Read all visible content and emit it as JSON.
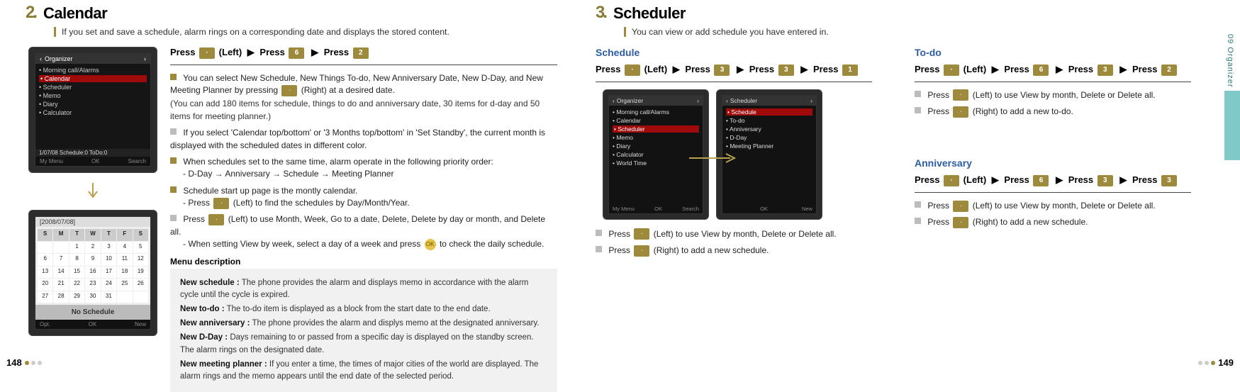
{
  "side_label": "09  Organizer",
  "page_left": "148",
  "page_right": "149",
  "calendar": {
    "num": "2",
    "dot": ".",
    "title": "Calendar",
    "sub": "If you set and save a schedule, alarm rings on a corresponding date and displays the stored content.",
    "press": {
      "p1": "Press",
      "left": "(Left)",
      "arrow": "▶",
      "p2": "Press",
      "p3": "Press",
      "k1": "·",
      "k2": "6",
      "k3": "2"
    },
    "phone1": {
      "title": "Organizer",
      "rows": [
        "Morning call/Alarms",
        "Calendar",
        "Scheduler",
        "Memo",
        "Diary",
        "Calculator"
      ],
      "sel_idx": 1,
      "date": "1/07/08   Schedule:0   ToDo:0",
      "foot": [
        "My Menu",
        "OK",
        "Search"
      ]
    },
    "phone2": {
      "title": "[2008/07/08]",
      "dow": [
        "S",
        "M",
        "T",
        "W",
        "T",
        "F",
        "S"
      ],
      "days": [
        "",
        "",
        "1",
        "2",
        "3",
        "4",
        "5",
        "6",
        "7",
        "8",
        "9",
        "10",
        "11",
        "12",
        "13",
        "14",
        "15",
        "16",
        "17",
        "18",
        "19",
        "20",
        "21",
        "22",
        "23",
        "24",
        "25",
        "26",
        "27",
        "28",
        "29",
        "30",
        "31",
        "",
        ""
      ],
      "nosched": "No Schedule",
      "foot": [
        "Opt.",
        "OK",
        "New"
      ]
    },
    "bullets": [
      {
        "html": [
          "You can select New Schedule, New Things To-do, New Anniversary Date, New D-Day, and New Meeting Planner by pressing ",
          " (Right) at a desired date."
        ],
        "note": "(You can add 180 items for schedule, things to do and anniversary date, 30 items for d-day and 50 items for meeting planner.)"
      },
      {
        "text": "If you select 'Calendar top/bottom' or '3 Months top/bottom' in 'Set Standby', the current month is displayed with the scheduled dates in different color."
      },
      {
        "text": "When schedules set to the same time, alarm operate in the following priority order:",
        "sub": "D-Day → Anniversary → Schedule → Meeting Planner"
      },
      {
        "text": "Schedule start up page is the montly calendar.",
        "sub2": [
          "Press ",
          " (Left) to find the schedules by Day/Month/Year."
        ]
      },
      {
        "html": [
          "Press ",
          " (Left) to use Month, Week, Go to a date, Delete, Delete by day or month, and Delete all."
        ],
        "sub2b": [
          "When setting View by week, select a day of a week and press ",
          "  to check the daily schedule."
        ]
      }
    ],
    "menu_title": "Menu description",
    "menu": [
      {
        "lbl": "New schedule :",
        "txt": "The phone provides the alarm and displays memo in accordance with the alarm cycle until the cycle is expired."
      },
      {
        "lbl": "New to-do :",
        "txt": "The to-do item is displayed as a block from the start date to the end date."
      },
      {
        "lbl": "New anniversary :",
        "txt": "The phone provides the alarm and displys memo at the designated anniversary."
      },
      {
        "lbl": "New D-Day :",
        "txt": "Days remaining to or passed from a specific day is displayed on the standby screen. The alarm rings on the designated date."
      },
      {
        "lbl": "New meeting planner :",
        "txt": "If you enter a time, the times of major cities of the world are displayed. The alarm rings and the memo appears until the end date of the selected period."
      }
    ]
  },
  "scheduler": {
    "num": "3",
    "dot": ".",
    "title": "Scheduler",
    "sub": "You can view or add schedule you have entered in.",
    "schedule": {
      "title": "Schedule",
      "press": {
        "p": "Press",
        "left": "(Left)",
        "arrow": "▶",
        "k1": "·",
        "k2": "3",
        "k3": "3",
        "k4": "1"
      },
      "phoneL": {
        "title": "Organizer",
        "rows": [
          "Morning call/Alarms",
          "Calendar",
          "Scheduler",
          "Memo",
          "Diary",
          "Calculator",
          "World Time"
        ],
        "sel_idx": 2,
        "foot": [
          "My Menu",
          "OK",
          "Search"
        ]
      },
      "phoneR": {
        "title": "Scheduler",
        "rows": [
          "Schedule",
          "To-do",
          "Anniversary",
          "D-Day",
          "Meeting Planner"
        ],
        "sel_idx": 0,
        "foot": [
          "",
          "OK",
          "New"
        ]
      },
      "b1": [
        "Press ",
        " (Left) to use View by month, Delete or Delete all."
      ],
      "b2": [
        "Press ",
        " (Right) to add a new schedule."
      ]
    },
    "todo": {
      "title": "To-do",
      "press": {
        "p": "Press",
        "left": "(Left)",
        "arrow": "▶",
        "k1": "·",
        "k2": "6",
        "k3": "3",
        "k4": "2"
      },
      "b1": [
        "Press ",
        " (Left) to use View by month, Delete or Delete all."
      ],
      "b2": [
        "Press ",
        " (Right) to add a new to-do."
      ]
    },
    "anniv": {
      "title": "Anniversary",
      "press": {
        "p": "Press",
        "left": "(Left)",
        "arrow": "▶",
        "k1": "·",
        "k2": "6",
        "k3": "3",
        "k4": "3"
      },
      "b1": [
        "Press ",
        " (Left) to use View by month, Delete or Delete all."
      ],
      "b2": [
        "Press ",
        " (Right) to add a new schedule."
      ]
    }
  }
}
